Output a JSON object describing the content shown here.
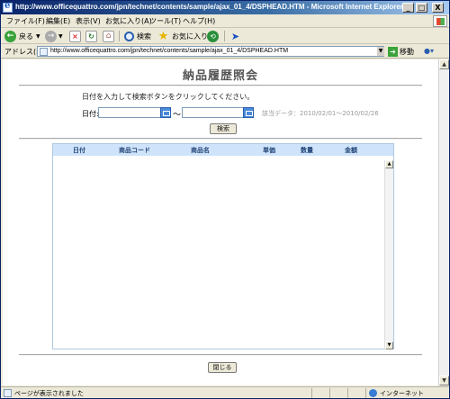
{
  "window": {
    "title": "http://www.officequattro.com/jpn/technet/contents/sample/ajax_01_4/DSPHEAD.HTM - Microsoft Internet Explorer",
    "minimize": "_",
    "maximize": "□",
    "close": "X"
  },
  "menu": {
    "items": [
      {
        "label": "ファイル(F)"
      },
      {
        "label": "編集(E)"
      },
      {
        "label": "表示(V)"
      },
      {
        "label": "お気に入り(A)"
      },
      {
        "label": "ツール(T)"
      },
      {
        "label": "ヘルプ(H)"
      }
    ]
  },
  "toolbar": {
    "back_label": "戻る",
    "search_label": "検索",
    "favorites_label": "お気に入り"
  },
  "address": {
    "label": "アドレス(D)",
    "url": "http://www.officequattro.com/jpn/technet/contents/sample/ajax_01_4/DSPHEAD.HTM",
    "go_label": "移動"
  },
  "page": {
    "title": "納品履歴照会",
    "instruction": "日付を入力して検索ボタンをクリックしてください。",
    "date_label": "日付:",
    "tilde": "～",
    "note": "該当データ：2010/02/01～2010/02/26",
    "search_button": "検索",
    "close_button": "閉じる",
    "date_from": "",
    "date_to": ""
  },
  "grid": {
    "columns": [
      "日付",
      "商品コード",
      "商品名",
      "単価",
      "数量",
      "金額"
    ],
    "rows": []
  },
  "status": {
    "text": "ページが表示されました",
    "zone": "インターネット"
  }
}
